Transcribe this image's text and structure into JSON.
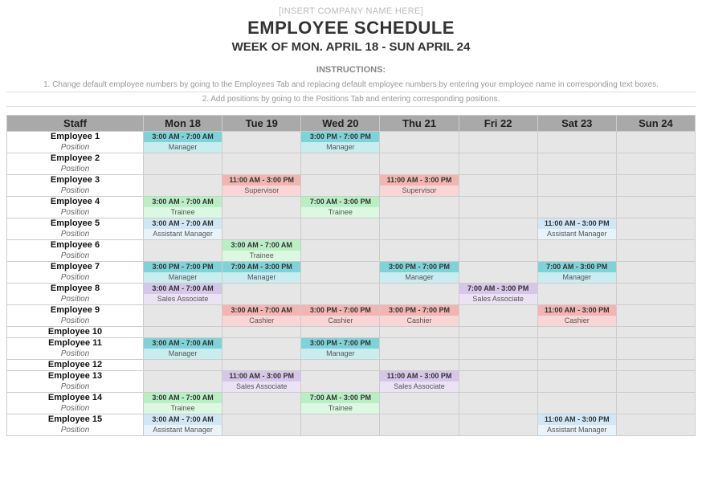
{
  "header": {
    "company_placeholder": "[INSERT COMPANY NAME HERE]",
    "title": "EMPLOYEE SCHEDULE",
    "week": "WEEK OF MON. APRIL 18 - SUN APRIL 24"
  },
  "instructions": {
    "heading": "INSTRUCTIONS:",
    "line1": "1. Change default employee numbers by going to the Employees Tab and replacing default employee numbers by entering your employee name in corresponding text boxes.",
    "line2": "2. Add positions by going to the Positions Tab and entering corresponding positions."
  },
  "columns": {
    "staff": "Staff",
    "days": [
      "Mon 18",
      "Tue 19",
      "Wed 20",
      "Thu 21",
      "Fri 22",
      "Sat 23",
      "Sun 24"
    ]
  },
  "position_label": "Position",
  "palette": {
    "Manager": {
      "top": "bg-teal",
      "bot": "bg-teal-l"
    },
    "Supervisor": {
      "top": "bg-pink",
      "bot": "bg-pink-l"
    },
    "Trainee": {
      "top": "bg-green",
      "bot": "bg-green-l"
    },
    "Assistant Manager": {
      "top": "bg-blue-l",
      "bot": "bg-blue-xl"
    },
    "Sales Associate": {
      "top": "bg-purple",
      "bot": "bg-purple-l"
    },
    "Cashier": {
      "top": "bg-pink",
      "bot": "bg-pink-l"
    }
  },
  "rows": [
    {
      "name": "Employee 1",
      "show_position": true,
      "shifts": {
        "0": {
          "time": "3:00 AM - 7:00 AM",
          "pos": "Manager"
        },
        "2": {
          "time": "3:00 PM - 7:00 PM",
          "pos": "Manager"
        }
      }
    },
    {
      "name": "Employee 2",
      "show_position": true,
      "shifts": {}
    },
    {
      "name": "Employee 3",
      "show_position": true,
      "shifts": {
        "1": {
          "time": "11:00 AM - 3:00 PM",
          "pos": "Supervisor"
        },
        "3": {
          "time": "11:00 AM - 3:00 PM",
          "pos": "Supervisor"
        }
      }
    },
    {
      "name": "Employee 4",
      "show_position": true,
      "shifts": {
        "0": {
          "time": "3:00 AM - 7:00 AM",
          "pos": "Trainee"
        },
        "2": {
          "time": "7:00 AM - 3:00 PM",
          "pos": "Trainee"
        }
      }
    },
    {
      "name": "Employee 5",
      "show_position": true,
      "shifts": {
        "0": {
          "time": "3:00 AM - 7:00 AM",
          "pos": "Assistant Manager"
        },
        "5": {
          "time": "11:00 AM - 3:00 PM",
          "pos": "Assistant Manager"
        }
      }
    },
    {
      "name": "Employee 6",
      "show_position": true,
      "shifts": {
        "1": {
          "time": "3:00 AM - 7:00 AM",
          "pos": "Trainee"
        }
      }
    },
    {
      "name": "Employee 7",
      "show_position": true,
      "shifts": {
        "0": {
          "time": "3:00 PM - 7:00 PM",
          "pos": "Manager"
        },
        "1": {
          "time": "7:00 AM - 3:00 PM",
          "pos": "Manager"
        },
        "3": {
          "time": "3:00 PM - 7:00 PM",
          "pos": "Manager"
        },
        "5": {
          "time": "7:00 AM - 3:00 PM",
          "pos": "Manager"
        }
      }
    },
    {
      "name": "Employee 8",
      "show_position": true,
      "shifts": {
        "0": {
          "time": "3:00 AM - 7:00 AM",
          "pos": "Sales Associate"
        },
        "4": {
          "time": "7:00 AM - 3:00 PM",
          "pos": "Sales Associate"
        }
      }
    },
    {
      "name": "Employee 9",
      "show_position": true,
      "shifts": {
        "1": {
          "time": "3:00 AM - 7:00 AM",
          "pos": "Cashier"
        },
        "2": {
          "time": "3:00 PM - 7:00 PM",
          "pos": "Cashier"
        },
        "3": {
          "time": "3:00 PM - 7:00 PM",
          "pos": "Cashier"
        },
        "5": {
          "time": "11:00 AM - 3:00 PM",
          "pos": "Cashier"
        }
      }
    },
    {
      "name": "Employee 10",
      "show_position": false,
      "shifts": {}
    },
    {
      "name": "Employee 11",
      "show_position": true,
      "shifts": {
        "0": {
          "time": "3:00 AM - 7:00 AM",
          "pos": "Manager"
        },
        "2": {
          "time": "3:00 PM - 7:00 PM",
          "pos": "Manager"
        }
      }
    },
    {
      "name": "Employee 12",
      "show_position": false,
      "shifts": {}
    },
    {
      "name": "Employee 13",
      "show_position": true,
      "shifts": {
        "1": {
          "time": "11:00 AM - 3:00 PM",
          "pos": "Sales Associate"
        },
        "3": {
          "time": "11:00 AM - 3:00 PM",
          "pos": "Sales Associate"
        }
      }
    },
    {
      "name": "Employee 14",
      "show_position": true,
      "shifts": {
        "0": {
          "time": "3:00 AM - 7:00 AM",
          "pos": "Trainee"
        },
        "2": {
          "time": "7:00 AM - 3:00 PM",
          "pos": "Trainee"
        }
      }
    },
    {
      "name": "Employee 15",
      "show_position": true,
      "shifts": {
        "0": {
          "time": "3:00 AM - 7:00 AM",
          "pos": "Assistant Manager"
        },
        "5": {
          "time": "11:00 AM - 3:00 PM",
          "pos": "Assistant Manager"
        }
      }
    }
  ]
}
